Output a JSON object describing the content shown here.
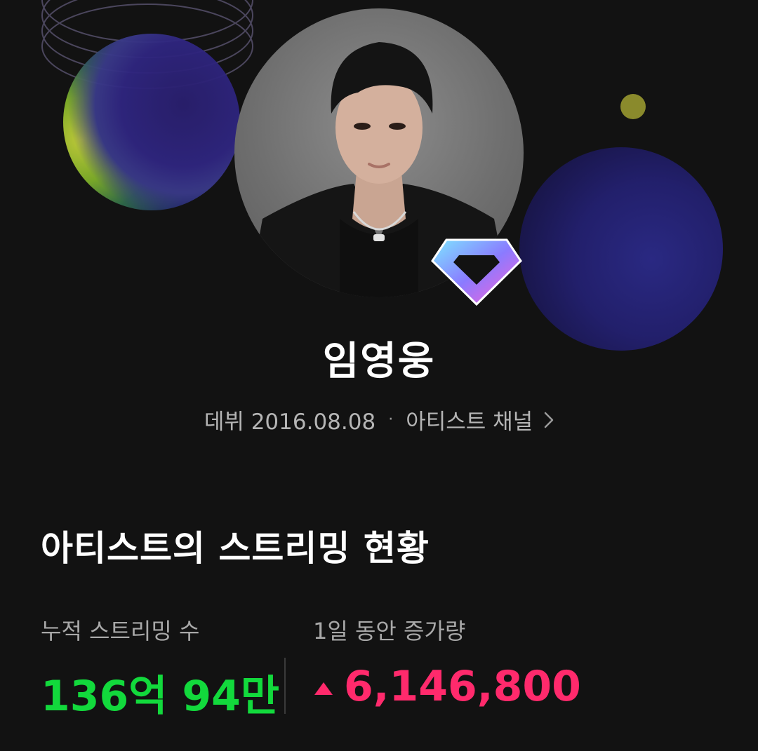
{
  "artist": {
    "name": "임영웅",
    "debut_label": "데뷔 2016.08.08",
    "separator": "·",
    "channel_link_label": "아티스트 채널"
  },
  "streaming": {
    "section_title": "아티스트의 스트리밍 현황",
    "cumulative_label": "누적 스트리밍 수",
    "cumulative_value": "136억 94만",
    "daily_label": "1일 동안 증가량",
    "daily_value": "6,146,800"
  },
  "icons": {
    "badge": "diamond-badge-icon",
    "chevron": "chevron-right-icon",
    "trend": "triangle-up-icon"
  },
  "colors": {
    "background": "#121212",
    "cumulative_value": "#12d93c",
    "daily_value": "#ff2a6c",
    "muted_text": "#b5b5b5"
  }
}
